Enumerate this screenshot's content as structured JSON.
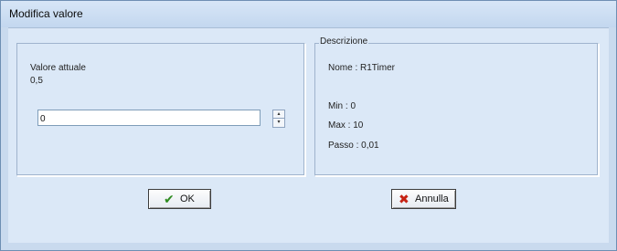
{
  "window": {
    "title": "Modifica valore"
  },
  "value_panel": {
    "current_label": "Valore attuale",
    "current_value": "0,5",
    "input_value": "0",
    "spin_up": "▴",
    "spin_down": "▾"
  },
  "description": {
    "legend": "Descrizione",
    "name": "Nome : R1Timer",
    "min": "Min : 0",
    "max": "Max : 10",
    "step": "Passo : 0,01"
  },
  "buttons": {
    "ok_label": "OK",
    "ok_icon": "checkmark-icon",
    "cancel_label": "Annulla",
    "cancel_icon": "x-icon"
  },
  "colors": {
    "ok_icon": "#2e8b1f",
    "cancel_icon": "#c62314",
    "window_bg": "#c9daee",
    "client_bg": "#dbe8f7"
  }
}
